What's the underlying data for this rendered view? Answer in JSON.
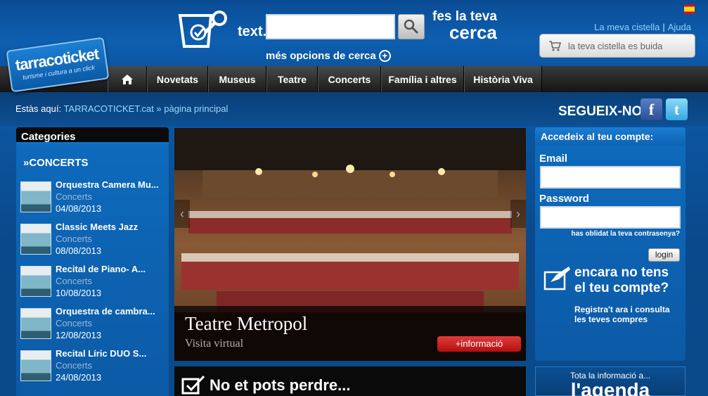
{
  "header": {
    "logo_name": "tarracoticket",
    "logo_tagline": "turisme i cultura a un click",
    "search_label": "text.",
    "search_value": "",
    "tagline_line1": "fes la teva",
    "tagline_line2": "cerca",
    "more_options": "més opcions de cerca",
    "links": [
      "La meva cistella",
      "Ajuda"
    ],
    "link_separator": "|",
    "cart_text": "la teva cistella es buida"
  },
  "nav": {
    "items": [
      "Novetats",
      "Museus",
      "Teatre",
      "Concerts",
      "Família i altres",
      "Història Viva"
    ]
  },
  "breadcrumb": {
    "prefix": "Estàs aquí:",
    "root": "TARRACOTICKET.cat",
    "separator": "»",
    "current": "pàgina principal"
  },
  "social": {
    "follow": "SEGUEIX-NOS",
    "facebook": "f",
    "twitter": "t"
  },
  "categories": {
    "title": "Categories",
    "section": "»CONCERTS",
    "events": [
      {
        "title": "Orquestra Camera Mu...",
        "category": "Concerts",
        "date": "04/08/2013"
      },
      {
        "title": "Classic Meets Jazz",
        "category": "Concerts",
        "date": "08/08/2013"
      },
      {
        "title": "Recital de Piano- A...",
        "category": "Concerts",
        "date": "10/08/2013"
      },
      {
        "title": "Orquestra de cambra...",
        "category": "Concerts",
        "date": "12/08/2013"
      },
      {
        "title": "Recital Líric DUO S...",
        "category": "Concerts",
        "date": "24/08/2013"
      }
    ]
  },
  "slider": {
    "title": "Teatre Metropol",
    "subtitle": "Visita virtual",
    "button": "+informació",
    "prev": "‹",
    "next": "›"
  },
  "dont_miss": {
    "title": "No et pots perdre..."
  },
  "login": {
    "title": "Accedeix al teu compte:",
    "email_label": "Email",
    "password_label": "Password",
    "forgot": "has oblidat la teva contrasenya?",
    "button": "login",
    "no_account_title": "encara no tens el teu compte?",
    "no_account_text": "Registra't ara i consulta les teves compres"
  },
  "agenda": {
    "text": "Tota la informació a...",
    "logo": "l'agenda"
  },
  "colors": {
    "accent_blue": "#0d5aa8",
    "link_blue": "#9ed7ff",
    "info_red": "#d42424",
    "nav_dark": "#1a1a1a"
  }
}
